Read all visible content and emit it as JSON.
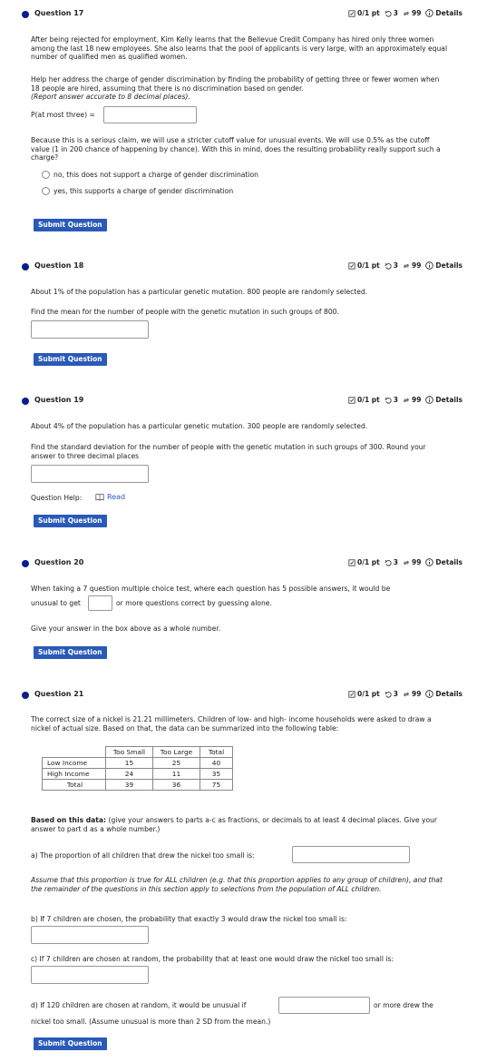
{
  "meta": {
    "score": "0/1 pt",
    "tries": "3",
    "retries": "99",
    "details": "Details"
  },
  "submit_label": "Submit Question",
  "q17": {
    "title": "Question 17",
    "para1": "After being rejected for employment, Kim Kelly learns that the Bellevue Credit Company has hired only three women among the last 18 new employees. She also learns that the pool of applicants is very large, with an approximately equal number of qualified men as qualified women.",
    "para2": "Help her address the charge of gender discrimination by finding the probability of getting three or fewer women when 18 people are hired, assuming that there is no discrimination based on gender.",
    "para2_italic": "(Report answer accurate to 8 decimal places).",
    "prompt": "P(at most three) =",
    "para3": "Because this is a serious claim, we will use a stricter cutoff value for unusual events. We will use 0.5% as the cutoff value (1 in 200 chance of happening by chance). With this in mind, does the resulting probability really support such a charge?",
    "options": [
      "no, this does not support a charge of gender discrimination",
      "yes, this supports a charge of gender discrimination"
    ]
  },
  "q18": {
    "title": "Question 18",
    "para1": "About 1% of the population has a particular genetic mutation. 800 people are randomly selected.",
    "para2": "Find the mean for the number of people with the genetic mutation in such groups of 800."
  },
  "q19": {
    "title": "Question 19",
    "para1": "About 4% of the population has a particular genetic mutation. 300 people are randomly selected.",
    "para2": "Find the standard deviation for the number of people with the genetic mutation in such groups of 300. Round your answer to three decimal places",
    "help_label": "Question Help:",
    "read_label": "Read"
  },
  "q20": {
    "title": "Question 20",
    "line1": "When taking a 7 question multiple choice test, where each question has 5 possible answers, it would be",
    "line2a": "unusual to get",
    "line2b": "or more questions correct by guessing alone.",
    "para2": "Give your answer in the box above as a whole number."
  },
  "q21": {
    "title": "Question 21",
    "para1": "The correct size of a nickel is 21.21 millimeters. Children of low- and high- income households were asked to draw a nickel of actual size. Based on that, the data can be summarized into the following table:",
    "table": {
      "headers": [
        "Too Small",
        "Too Large",
        "Total"
      ],
      "rows": [
        {
          "label": "Low Income",
          "values": [
            "15",
            "25",
            "40"
          ]
        },
        {
          "label": "High Income",
          "values": [
            "24",
            "11",
            "35"
          ]
        },
        {
          "label": "Total",
          "values": [
            "39",
            "36",
            "75"
          ]
        }
      ]
    },
    "instr_bold": "Based on this data:",
    "instr_rest": " (give your answers to parts a-c as fractions, or decimals to at least 4 decimal places. Give your answer to part d as a whole number.)",
    "part_a": "a) The proportion of all children that drew the nickel too small is:",
    "assume": "Assume that this proportion is true for ALL children (e.g. that this proportion applies to any group of children), and that the remainder of the questions in this section apply to selections from the population of ALL children.",
    "part_b": "b) If 7 children are chosen, the probability that exactly 3 would draw the nickel too small is:",
    "part_c": "c) If 7 children are chosen at random, the probability that at least one would draw the nickel too small is:",
    "part_d1": "d) If 120 children are chosen at random, it would be unusual if",
    "part_d2": "or more drew the",
    "part_d3": "nickel too small. (Assume unusual is more than 2 SD from the mean.)"
  }
}
